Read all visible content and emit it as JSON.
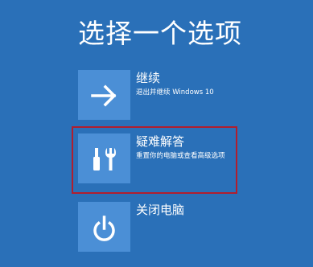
{
  "page": {
    "title": "选择一个选项"
  },
  "options": [
    {
      "id": "continue",
      "label": "继续",
      "description": "退出并继续 Windows 10",
      "icon": "arrow-right-icon"
    },
    {
      "id": "troubleshoot",
      "label": "疑难解答",
      "description": "重置你的电脑或查看高级选项",
      "icon": "tools-icon"
    },
    {
      "id": "shutdown",
      "label": "关闭电脑",
      "description": "",
      "icon": "power-icon"
    }
  ],
  "colors": {
    "background": "#2a70b8",
    "tile": "#4b8fd6",
    "highlight": "#b01e2e",
    "text": "#ffffff"
  }
}
